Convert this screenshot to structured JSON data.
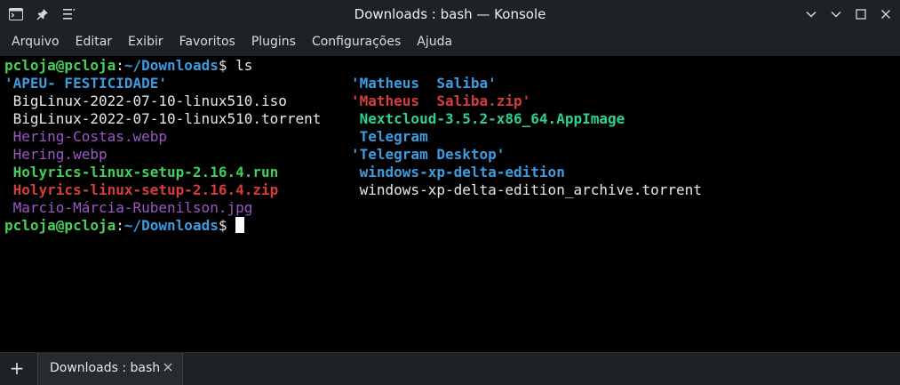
{
  "window": {
    "title": "Downloads : bash — Konsole"
  },
  "titlebar": {
    "left_icons": [
      "terminal-app-icon",
      "pin-icon",
      "hamburger-menu-icon"
    ],
    "controls": [
      "chevron-down-icon",
      "minimize-icon",
      "maximize-icon",
      "close-icon"
    ]
  },
  "menu": {
    "items": [
      "Arquivo",
      "Editar",
      "Exibir",
      "Favoritos",
      "Plugins",
      "Configurações",
      "Ajuda"
    ]
  },
  "terminal": {
    "prompt1": {
      "user_host": "pcloja@pcloja",
      "colon": ":",
      "path": "~/Downloads",
      "dollar": "$ ",
      "command": "ls"
    },
    "listing_left": [
      {
        "text": "'APEU- FESTICIDADE'",
        "kind": "dir"
      },
      {
        "text": " BigLinux-2022-07-10-linux510.iso",
        "kind": "file"
      },
      {
        "text": " BigLinux-2022-07-10-linux510.torrent",
        "kind": "file"
      },
      {
        "text": " Hering-Costas.webp",
        "kind": "image"
      },
      {
        "text": " Hering.webp",
        "kind": "image"
      },
      {
        "text": " Holyrics-linux-setup-2.16.4.run",
        "kind": "exec"
      },
      {
        "text": " Holyrics-linux-setup-2.16.4.zip",
        "kind": "archive"
      },
      {
        "text": " Marcio-Márcia-Rubenilson.jpg",
        "kind": "image"
      }
    ],
    "listing_right": [
      {
        "text": "'Matheus  Saliba'",
        "kind": "dir"
      },
      {
        "text": "'Matheus  Saliba.zip'",
        "kind": "archive"
      },
      {
        "text": " Nextcloud-3.5.2-x86_64.AppImage",
        "kind": "exec2"
      },
      {
        "text": " Telegram",
        "kind": "dir"
      },
      {
        "text": "'Telegram Desktop'",
        "kind": "dir"
      },
      {
        "text": " windows-xp-delta-edition",
        "kind": "dir"
      },
      {
        "text": " windows-xp-delta-edition_archive.torrent",
        "kind": "file"
      }
    ],
    "prompt2": {
      "user_host": "pcloja@pcloja",
      "colon": ":",
      "path": "~/Downloads",
      "dollar": "$ "
    }
  },
  "tabbar": {
    "new_tab_label": "+",
    "tabs": [
      {
        "label": "Downloads : bash",
        "close": "✕"
      }
    ]
  },
  "colors": {
    "background": "#000000",
    "chrome": "#1f2225",
    "prompt_user": "#49d05a",
    "prompt_path": "#3d9be0",
    "dir": "#3d9be0",
    "image": "#9b59c6",
    "exec": "#3fcf5a",
    "archive": "#d63c3c"
  }
}
